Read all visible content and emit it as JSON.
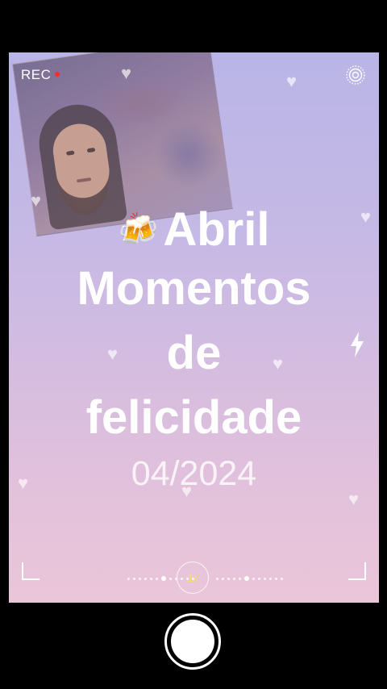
{
  "recording": {
    "label": "REC",
    "dot_color": "#ff2a2a"
  },
  "title": {
    "line1_emoji": "🍻",
    "line1": "Abril",
    "line2": "Momentos",
    "line3": "de",
    "line4": "felicidade"
  },
  "date": "04/2024",
  "zoom": {
    "label": "1x",
    "color": "#f3e25a"
  },
  "icons": {
    "top_right": "live-photo-icon",
    "flash": "lightning-icon",
    "decorations": "heart-icon"
  },
  "colors": {
    "gradient_top": "#b9b5e6",
    "gradient_bottom": "#ebc6d9"
  }
}
